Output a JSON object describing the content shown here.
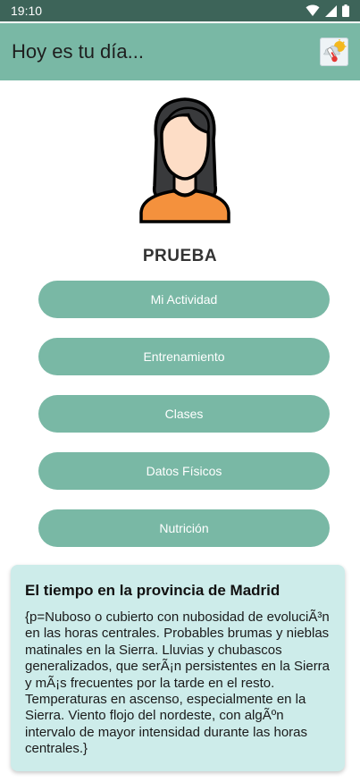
{
  "status_bar": {
    "time": "19:10",
    "icons": [
      "wifi-icon",
      "signal-icon",
      "battery-icon"
    ]
  },
  "app_bar": {
    "title": "Hoy es tu día...",
    "weather_icon": "weather-thermometer-icon"
  },
  "profile": {
    "name": "PRUEBA",
    "avatar": "woman-avatar"
  },
  "menu": {
    "items": [
      {
        "label": "Mi Actividad"
      },
      {
        "label": "Entrenamiento"
      },
      {
        "label": "Clases"
      },
      {
        "label": "Datos Físicos"
      },
      {
        "label": "Nutrición"
      }
    ]
  },
  "weather": {
    "title": "El tiempo en la provincia de Madrid",
    "text": "{p=Nuboso o cubierto con nubosidad de evoluciÃ³n en las horas centrales. Probables brumas y nieblas matinales en la Sierra. Lluvias y chubascos generalizados, que serÃ¡n persistentes en la Sierra y mÃ¡s frecuentes por la tarde en el resto. Temperaturas en ascenso, especialmente en la Sierra. Viento flojo del nordeste, con algÃºn intervalo de mayor intensidad durante las horas centrales.}"
  },
  "colors": {
    "status_bar": "#3d6459",
    "primary": "#79b8a5",
    "card": "#cdecea"
  }
}
